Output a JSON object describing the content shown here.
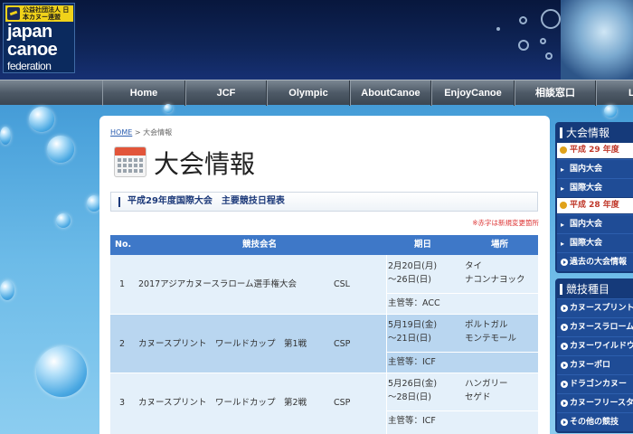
{
  "logo": {
    "org": "公益社団法人 日本カヌー連盟",
    "line1": "japan",
    "line2": "canoe",
    "line3": "federation"
  },
  "nav": [
    "Home",
    "JCF",
    "Olympic",
    "AboutCanoe",
    "EnjoyCanoe",
    "相談窓口",
    "L"
  ],
  "breadcrumb": {
    "home": "HOME",
    "sep": ">",
    "current": "大会情報"
  },
  "page_title": "大会情報",
  "subheading": "平成29年度国際大会　主要競技日程表",
  "note": "※赤字は新規変更箇所",
  "table": {
    "headers": [
      "No.",
      "競技会名",
      "期日",
      "場所"
    ],
    "rows": [
      {
        "no": "1",
        "name": "2017アジアカヌースラローム選手権大会",
        "code": "CSL",
        "date1": "2月20日(月)",
        "date2": "～26日(日)",
        "place1": "タイ",
        "place2": "ナコンナヨック",
        "host": "主管等：ACC"
      },
      {
        "no": "2",
        "name": "カヌースプリント　ワールドカップ　第1戦",
        "code": "CSP",
        "date1": "5月19日(金)",
        "date2": "～21日(日)",
        "place1": "ポルトガル",
        "place2": "モンテモール",
        "host": "主管等：ICF"
      },
      {
        "no": "3",
        "name": "カヌースプリント　ワールドカップ　第2戦",
        "code": "CSP",
        "date1": "5月26日(金)",
        "date2": "～28日(日)",
        "place1": "ハンガリー",
        "place2": "セゲド",
        "host": "主管等：ICF"
      }
    ]
  },
  "sidebar": {
    "events_title": "大会情報",
    "year29": "平成 29 年度",
    "year29_links": [
      "国内大会",
      "国際大会"
    ],
    "year28": "平成 28 年度",
    "year28_links": [
      "国内大会",
      "国際大会"
    ],
    "past": "過去の大会情報",
    "disciplines_title": "競技種目",
    "disciplines": [
      "カヌースプリント",
      "カヌースラローム",
      "カヌーワイルドウォーター",
      "カヌーポロ",
      "ドラゴンカヌー",
      "カヌーフリースタイル",
      "その他の競技"
    ]
  },
  "colors": {
    "header_dark": "#0f2558",
    "nav_gray": "#4e5a67",
    "table_head": "#3e78c8",
    "row_light": "#e4f0fa",
    "row_dark": "#b9d6f0",
    "sidebar_blue": "#153a7a",
    "accent_red": "#c0392b"
  }
}
